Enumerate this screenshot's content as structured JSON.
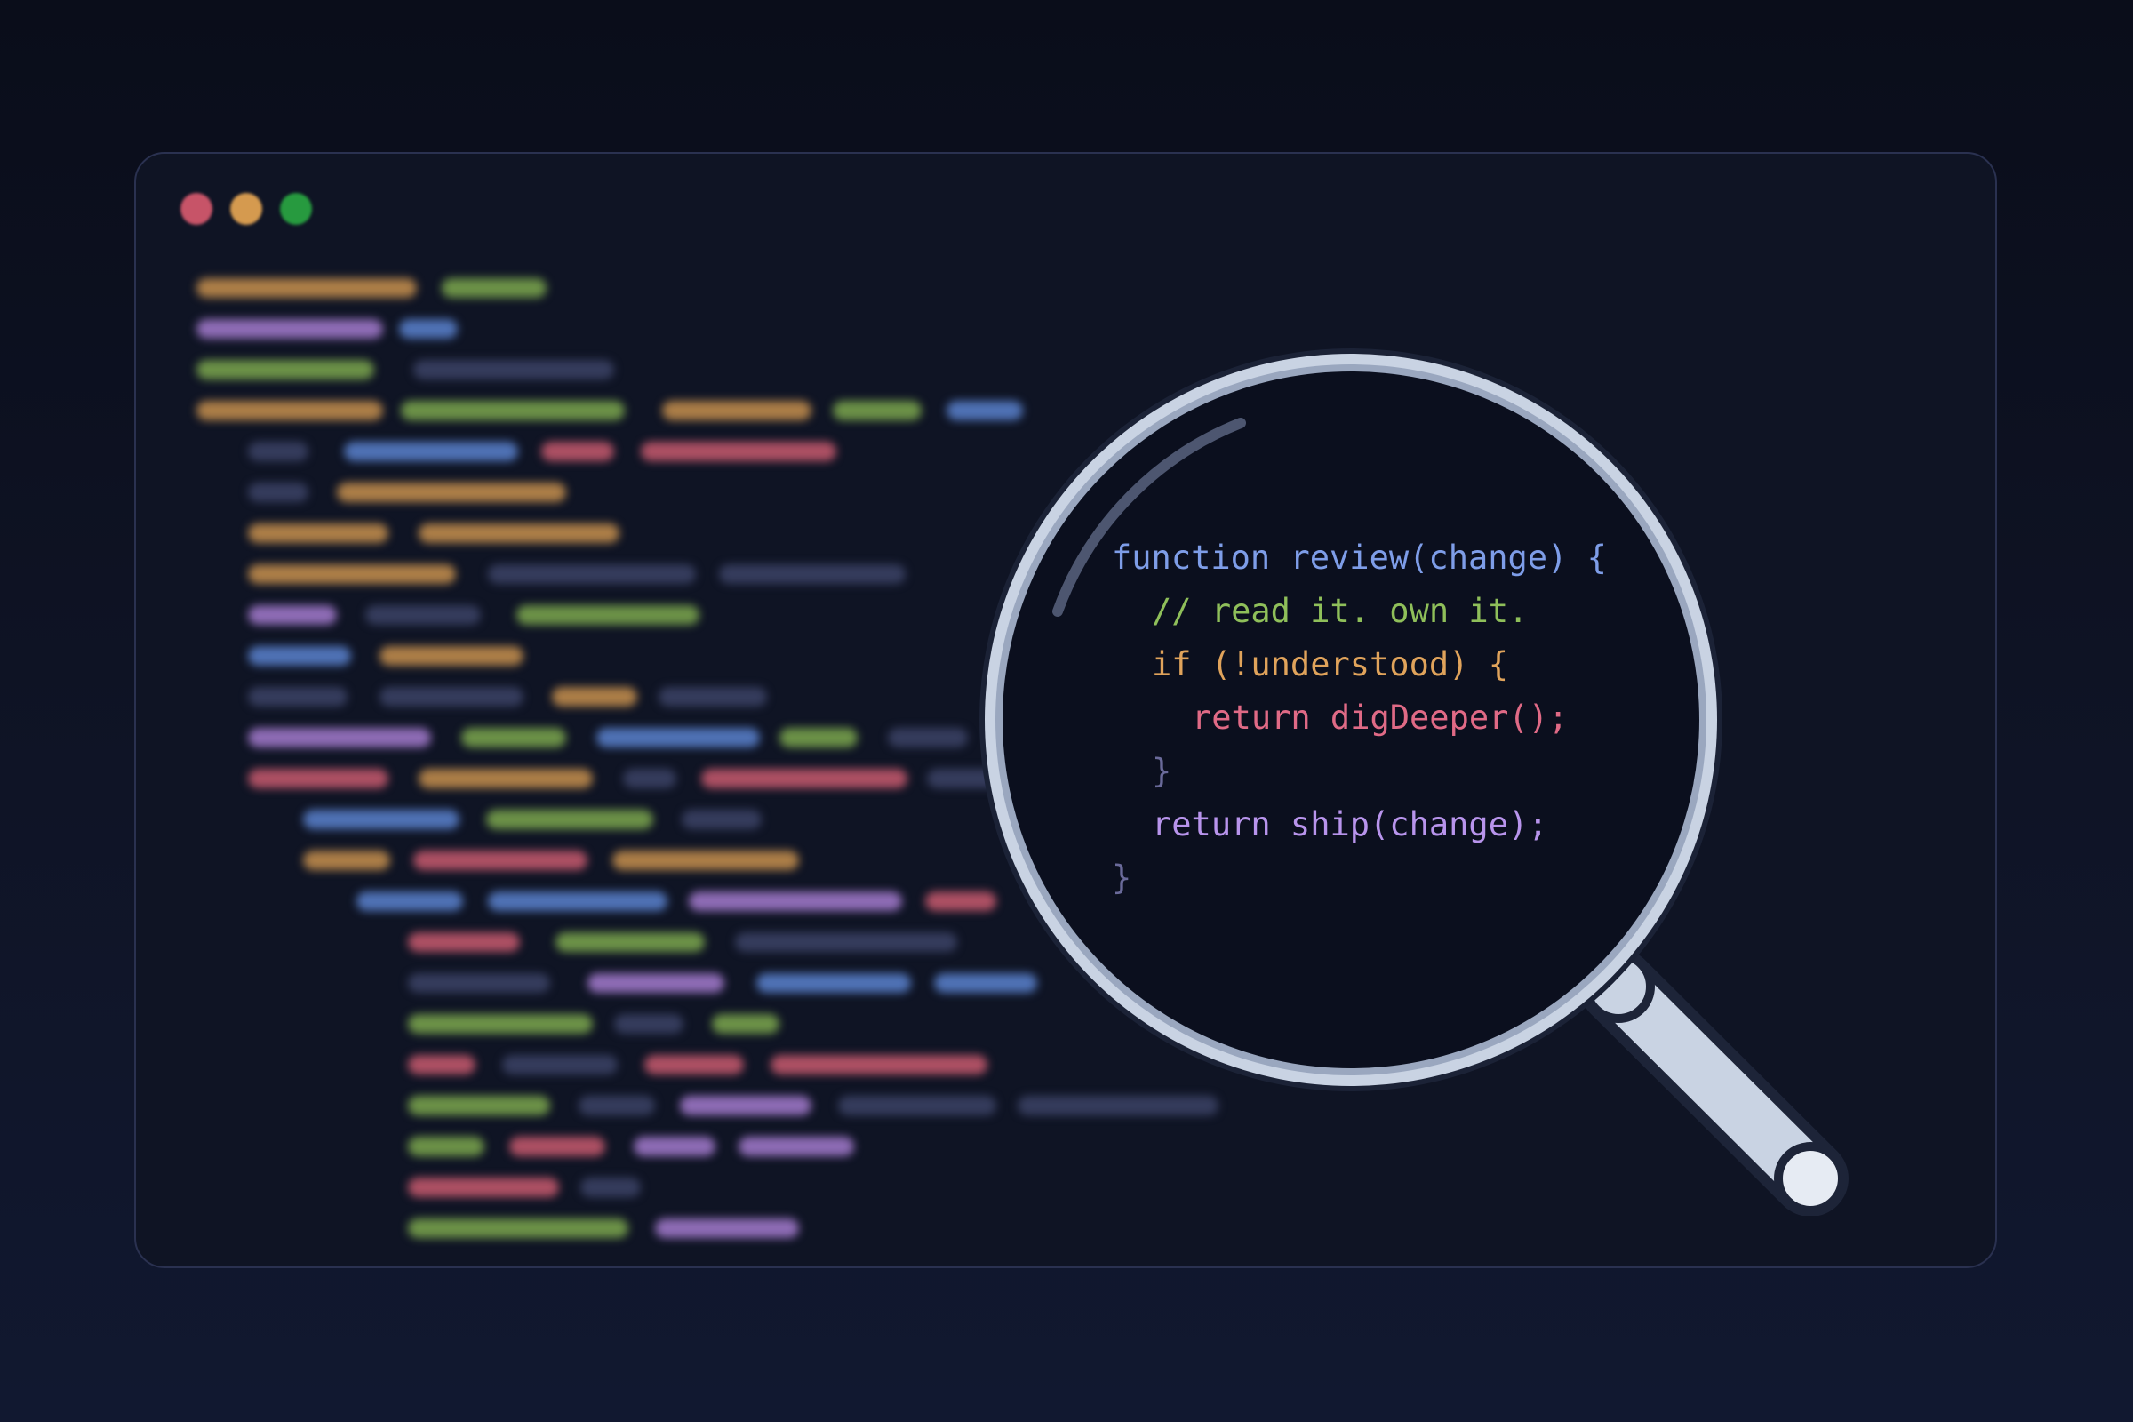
{
  "colors": {
    "orange": "#c8904e",
    "green": "#7ca84e",
    "purple": "#a47bcf",
    "blue": "#5b82cf",
    "red": "#c95a6e",
    "slate": "#3c4366",
    "window_dot_red": "#c75468",
    "window_dot_yellow": "#d59a4f",
    "window_dot_green": "#279a3f",
    "lens_rim": "#c9d3e3",
    "lens_glass": "#0b0f1e"
  },
  "window": {
    "dots": [
      "window-dot-close",
      "window-dot-minimize",
      "window-dot-maximize"
    ]
  },
  "magnifier": {
    "icon": "magnifier-icon",
    "code": [
      {
        "indent": 0,
        "tokens": [
          {
            "text": "function review(change) {",
            "color": "#7e9de8"
          }
        ]
      },
      {
        "indent": 1,
        "tokens": [
          {
            "text": "// read it. own it.",
            "color": "#8fbf5a"
          }
        ]
      },
      {
        "indent": 1,
        "tokens": [
          {
            "text": "if (!understood) {",
            "color": "#e0a35b"
          }
        ]
      },
      {
        "indent": 2,
        "tokens": [
          {
            "text": "return digDeeper();",
            "color": "#e06a86"
          }
        ]
      },
      {
        "indent": 1,
        "tokens": [
          {
            "text": "}",
            "color": "#6a6a9a"
          }
        ]
      },
      {
        "indent": 1,
        "tokens": [
          {
            "text": "return ship(change);",
            "color": "#b894ec"
          }
        ]
      },
      {
        "indent": 0,
        "tokens": [
          {
            "text": "}",
            "color": "#6a6a9a"
          }
        ]
      }
    ]
  }
}
